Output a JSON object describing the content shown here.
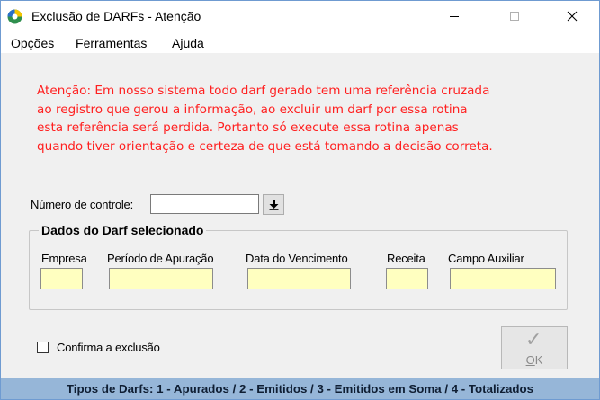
{
  "window": {
    "title": "Exclusão de DARFs - Atenção",
    "controls": [
      "minimize-icon",
      "maximize-icon",
      "close-icon"
    ]
  },
  "menu": {
    "opcoes": "Opções",
    "opcoes_key": "O",
    "opcoes_rest": "pções",
    "ferramentas_key": "F",
    "ferramentas_rest": "erramentas",
    "ajuda_key": "A",
    "ajuda_rest": "juda"
  },
  "warning": {
    "lines": [
      "Atenção: Em nosso sistema todo darf gerado tem uma referência cruzada",
      "ao registro que gerou a informação, ao excluir um darf por essa rotina",
      "esta referência será perdida. Portanto só execute essa rotina apenas",
      "quando tiver orientação e certeza de que está tomando a decisão correta."
    ]
  },
  "control_number": {
    "label": "Número de controle:",
    "value": ""
  },
  "darf_group": {
    "title": "Dados do Darf selecionado",
    "fields": [
      {
        "label": "Empresa",
        "value": ""
      },
      {
        "label": "Período de Apuração",
        "value": ""
      },
      {
        "label": "Data do Vencimento",
        "value": ""
      },
      {
        "label": "Receita",
        "value": ""
      },
      {
        "label": "Campo Auxiliar",
        "value": ""
      }
    ]
  },
  "confirm": {
    "label": "Confirma a exclusão",
    "checked": false
  },
  "ok_button": {
    "label_key": "O",
    "label_rest": "K",
    "enabled": false
  },
  "status_bar": {
    "text": "Tipos de Darfs: 1 - Apurados / 2 - Emitidos / 3 - Emitidos em Soma / 4 - Totalizados"
  },
  "colors": {
    "warning_text": "#ff2020",
    "field_background": "#ffffc0",
    "status_bar": "#96b6d8"
  }
}
